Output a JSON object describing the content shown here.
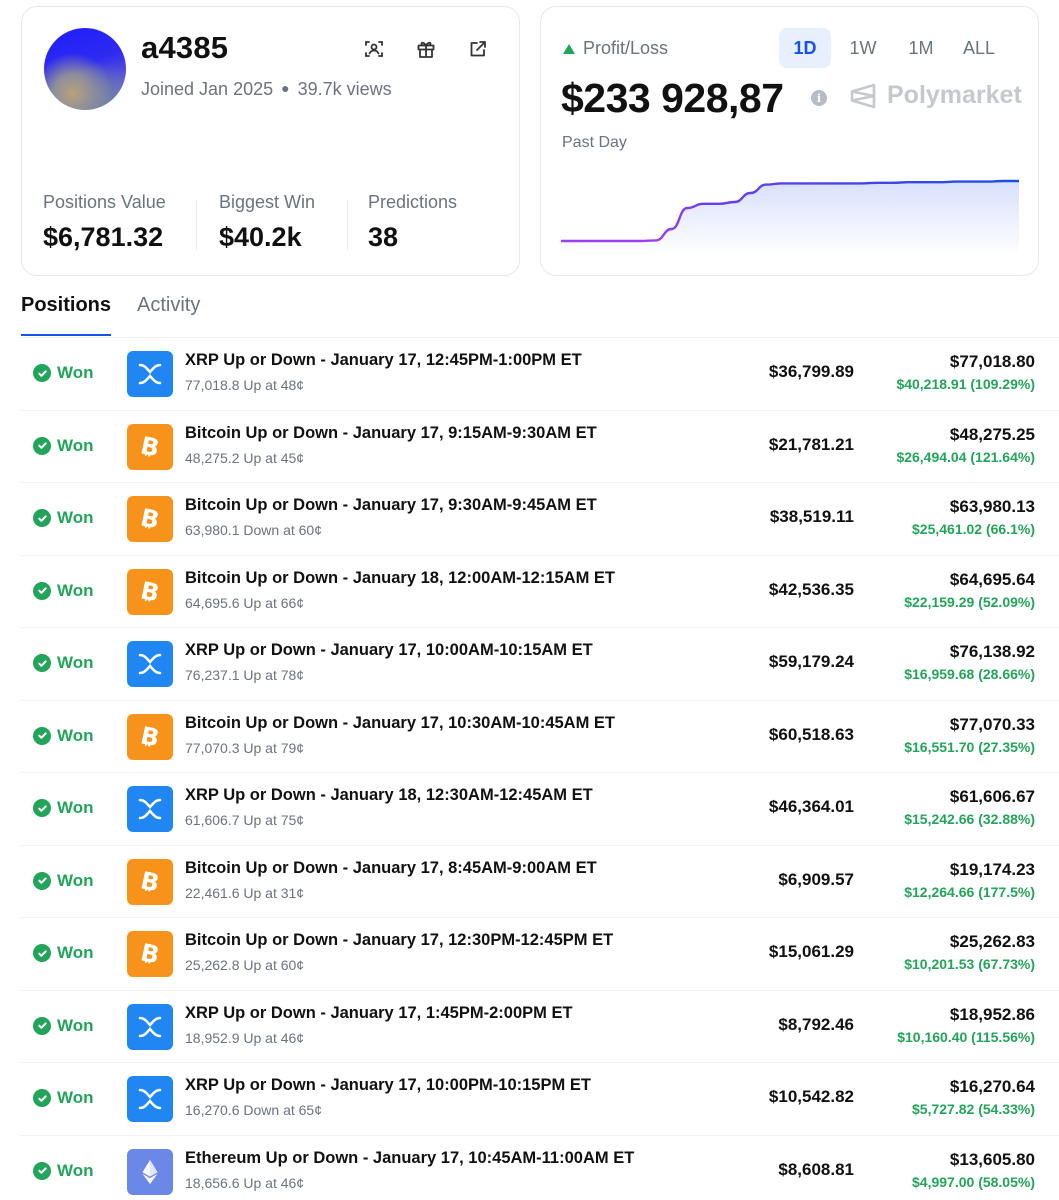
{
  "profile": {
    "username": "a4385",
    "joined": "Joined Jan 2025",
    "views": "39.7k views",
    "icons": [
      "scan-icon",
      "gift-icon",
      "share-icon"
    ],
    "stats": [
      {
        "label": "Positions Value",
        "value": "$6,781.32"
      },
      {
        "label": "Biggest Win",
        "value": "$40.2k"
      },
      {
        "label": "Predictions",
        "value": "38"
      }
    ]
  },
  "pnl": {
    "label": "Profit/Loss",
    "value": "$233 928,87",
    "period": "Past Day",
    "brand": "Polymarket",
    "ranges": [
      "1D",
      "1W",
      "1M",
      "ALL"
    ],
    "active_range": "1D",
    "colors": {
      "line_start": "#9b3ff0",
      "line_end": "#1c4fe0",
      "up": "#22a55b"
    },
    "trend": [
      0,
      0,
      0,
      0,
      0,
      0,
      0.01,
      0.2,
      0.55,
      0.62,
      0.62,
      0.65,
      0.8,
      0.94,
      0.96,
      0.96,
      0.96,
      0.96,
      0.96,
      0.96,
      0.97,
      0.97,
      0.98,
      0.98,
      0.98,
      0.99,
      0.99,
      0.99,
      1,
      1
    ]
  },
  "tabs": [
    {
      "label": "Positions",
      "active": true
    },
    {
      "label": "Activity",
      "active": false
    }
  ],
  "positions": [
    {
      "status": "Won",
      "coin": "xrp",
      "title": "XRP Up or Down - January 17, 12:45PM-1:00PM ET",
      "sub": "77,018.8 Up at 48¢",
      "amount": "$36,799.89",
      "value": "$77,018.80",
      "profit": "$40,218.91 (109.29%)"
    },
    {
      "status": "Won",
      "coin": "btc",
      "title": "Bitcoin Up or Down - January 17, 9:15AM-9:30AM ET",
      "sub": "48,275.2 Up at 45¢",
      "amount": "$21,781.21",
      "value": "$48,275.25",
      "profit": "$26,494.04 (121.64%)"
    },
    {
      "status": "Won",
      "coin": "btc",
      "title": "Bitcoin Up or Down - January 17, 9:30AM-9:45AM ET",
      "sub": "63,980.1 Down at 60¢",
      "amount": "$38,519.11",
      "value": "$63,980.13",
      "profit": "$25,461.02 (66.1%)"
    },
    {
      "status": "Won",
      "coin": "btc",
      "title": "Bitcoin Up or Down - January 18, 12:00AM-12:15AM ET",
      "sub": "64,695.6 Up at 66¢",
      "amount": "$42,536.35",
      "value": "$64,695.64",
      "profit": "$22,159.29 (52.09%)"
    },
    {
      "status": "Won",
      "coin": "xrp",
      "title": "XRP Up or Down - January 17, 10:00AM-10:15AM ET",
      "sub": "76,237.1 Up at 78¢",
      "amount": "$59,179.24",
      "value": "$76,138.92",
      "profit": "$16,959.68 (28.66%)"
    },
    {
      "status": "Won",
      "coin": "btc",
      "title": "Bitcoin Up or Down - January 17, 10:30AM-10:45AM ET",
      "sub": "77,070.3 Up at 79¢",
      "amount": "$60,518.63",
      "value": "$77,070.33",
      "profit": "$16,551.70 (27.35%)"
    },
    {
      "status": "Won",
      "coin": "xrp",
      "title": "XRP Up or Down - January 18, 12:30AM-12:45AM ET",
      "sub": "61,606.7 Up at 75¢",
      "amount": "$46,364.01",
      "value": "$61,606.67",
      "profit": "$15,242.66 (32.88%)"
    },
    {
      "status": "Won",
      "coin": "btc",
      "title": "Bitcoin Up or Down - January 17, 8:45AM-9:00AM ET",
      "sub": "22,461.6 Up at 31¢",
      "amount": "$6,909.57",
      "value": "$19,174.23",
      "profit": "$12,264.66 (177.5%)"
    },
    {
      "status": "Won",
      "coin": "btc",
      "title": "Bitcoin Up or Down - January 17, 12:30PM-12:45PM ET",
      "sub": "25,262.8 Up at 60¢",
      "amount": "$15,061.29",
      "value": "$25,262.83",
      "profit": "$10,201.53 (67.73%)"
    },
    {
      "status": "Won",
      "coin": "xrp",
      "title": "XRP Up or Down - January 17, 1:45PM-2:00PM ET",
      "sub": "18,952.9 Up at 46¢",
      "amount": "$8,792.46",
      "value": "$18,952.86",
      "profit": "$10,160.40 (115.56%)"
    },
    {
      "status": "Won",
      "coin": "xrp",
      "title": "XRP Up or Down - January 17, 10:00PM-10:15PM ET",
      "sub": "16,270.6 Down at 65¢",
      "amount": "$10,542.82",
      "value": "$16,270.64",
      "profit": "$5,727.82 (54.33%)"
    },
    {
      "status": "Won",
      "coin": "eth",
      "title": "Ethereum Up or Down - January 17, 10:45AM-11:00AM ET",
      "sub": "18,656.6 Up at 46¢",
      "amount": "$8,608.81",
      "value": "$13,605.80",
      "profit": "$4,997.00 (58.05%)"
    }
  ]
}
